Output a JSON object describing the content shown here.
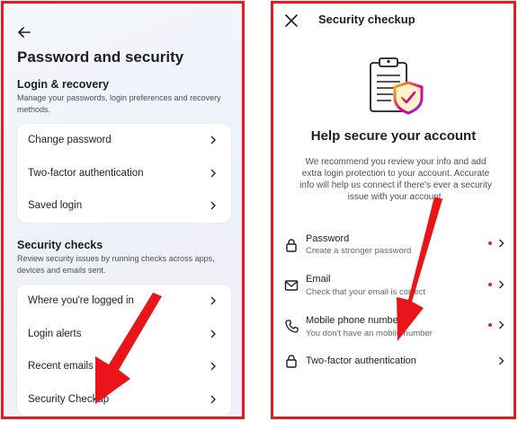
{
  "left_panel": {
    "title": "Password and security",
    "login_recovery": {
      "heading": "Login & recovery",
      "description": "Manage your passwords, login preferences and recovery methods.",
      "items": [
        {
          "label": "Change password"
        },
        {
          "label": "Two-factor authentication"
        },
        {
          "label": "Saved login"
        }
      ]
    },
    "security_checks": {
      "heading": "Security checks",
      "description": "Review security issues by running checks across apps, devices and emails sent.",
      "items": [
        {
          "label": "Where you're logged in"
        },
        {
          "label": "Login alerts"
        },
        {
          "label": "Recent emails"
        },
        {
          "label": "Security Checkup"
        }
      ]
    }
  },
  "right_panel": {
    "title": "Security checkup",
    "heading": "Help secure your account",
    "description": "We recommend you review your info and add extra login protection to your account. Accurate info will help us connect if there's ever a security issue with your account.",
    "items": [
      {
        "label": "Password",
        "subtitle": "Create a stronger password",
        "icon": "lock-icon",
        "alert": true
      },
      {
        "label": "Email",
        "subtitle": "Check that your email is correct",
        "icon": "envelope-icon",
        "alert": true
      },
      {
        "label": "Mobile phone number",
        "subtitle": "You don't have an mobile number",
        "icon": "phone-icon",
        "alert": true
      },
      {
        "label": "Two-factor authentication",
        "subtitle": "",
        "icon": "lock-icon",
        "alert": false
      }
    ]
  },
  "colors": {
    "frame_border": "#e31b23",
    "annotation_arrow": "#e8161b",
    "alert_dot": "#e41e3f",
    "shield_gradient": [
      "#f5c400",
      "#e6007e",
      "#7b2cf0"
    ]
  }
}
